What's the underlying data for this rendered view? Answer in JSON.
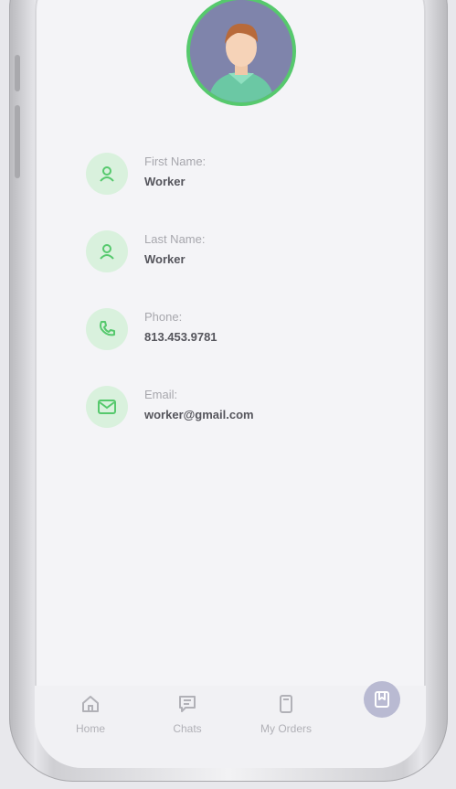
{
  "profile": {
    "fields": [
      {
        "label": "First Name:",
        "value": "Worker",
        "icon": "user-icon"
      },
      {
        "label": "Last Name:",
        "value": "Worker",
        "icon": "user-icon"
      },
      {
        "label": "Phone:",
        "value": "813.453.9781",
        "icon": "phone-icon"
      },
      {
        "label": "Email:",
        "value": "worker@gmail.com",
        "icon": "mail-icon"
      }
    ]
  },
  "bottom_nav": {
    "items": [
      {
        "label": "Home",
        "icon": "home-icon"
      },
      {
        "label": "Chats",
        "icon": "chat-icon"
      },
      {
        "label": "My Orders",
        "icon": "orders-icon"
      },
      {
        "label": "",
        "icon": "bookmark-icon"
      }
    ]
  },
  "colors": {
    "accent_green": "#56c96d",
    "icon_bg": "#d9f1dd",
    "nav_active_bg": "#b9bad2"
  }
}
